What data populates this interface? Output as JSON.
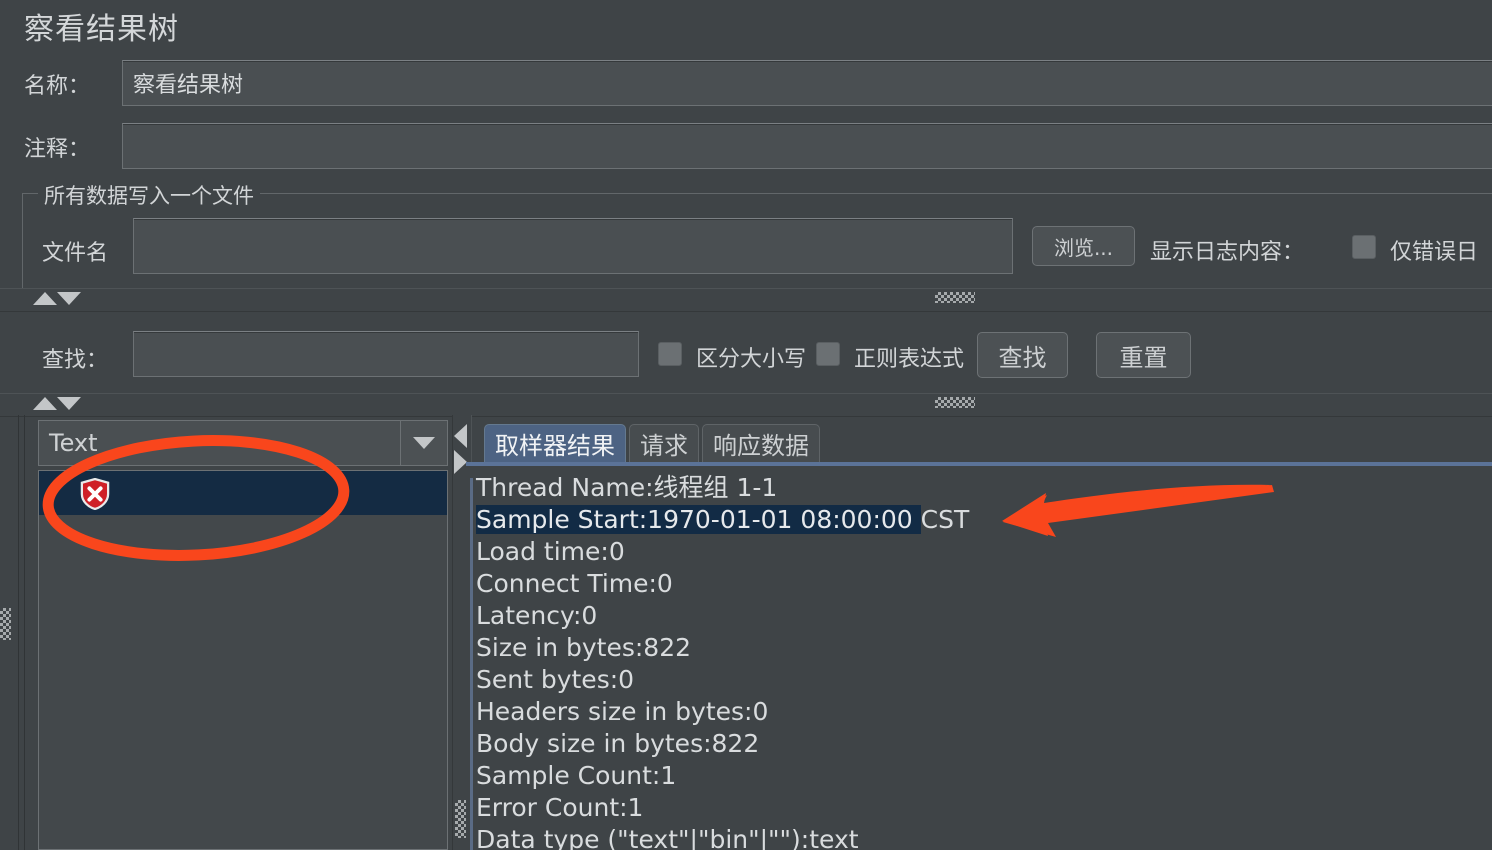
{
  "window": {
    "title": "察看结果树"
  },
  "form": {
    "name_label": "名称：",
    "name_value": "察看结果树",
    "comment_label": "注释：",
    "comment_value": ""
  },
  "file_group": {
    "legend": "所有数据写入一个文件",
    "filename_label": "文件名",
    "filename_value": "",
    "browse_button": "浏览...",
    "log_display_label": "显示日志内容：",
    "errors_only_label": "仅错误日"
  },
  "search": {
    "label": "查找：",
    "value": "",
    "case_sensitive_label": "区分大小写",
    "regex_label": "正则表达式",
    "find_button": "查找",
    "reset_button": "重置"
  },
  "tree_panel": {
    "renderer_value": "Text",
    "items": [
      {
        "label": "",
        "icon": "error-shield-icon",
        "selected": true
      }
    ]
  },
  "tabs": [
    {
      "label": "取样器结果",
      "active": true
    },
    {
      "label": "请求",
      "active": false
    },
    {
      "label": "响应数据",
      "active": false
    }
  ],
  "sampler_result": {
    "line1": "Thread Name:线程组 1-1",
    "line2_prefix": "Sample Start:1970-01-01 08:00:00 ",
    "line2_suffix": "CST",
    "line3": "Load time:0",
    "line4": "Connect Time:0",
    "line5": "Latency:0",
    "line6": "Size in bytes:822",
    "line7": "Sent bytes:0",
    "line8": "Headers size in bytes:0",
    "line9": "Body size in bytes:822",
    "line10": "Sample Count:1",
    "line11": "Error Count:1",
    "line12": "Data type (\"text\"|\"bin\"|\"\"):text"
  },
  "annotations": {
    "highlight_color": "#F9461C",
    "ellipse_name": "red-ellipse-annotation",
    "arrow_name": "red-arrow-annotation"
  },
  "colors": {
    "background": "#3f4447",
    "accent_tab": "#4d6383",
    "selection": "#142b43",
    "error": "#cf2027"
  }
}
